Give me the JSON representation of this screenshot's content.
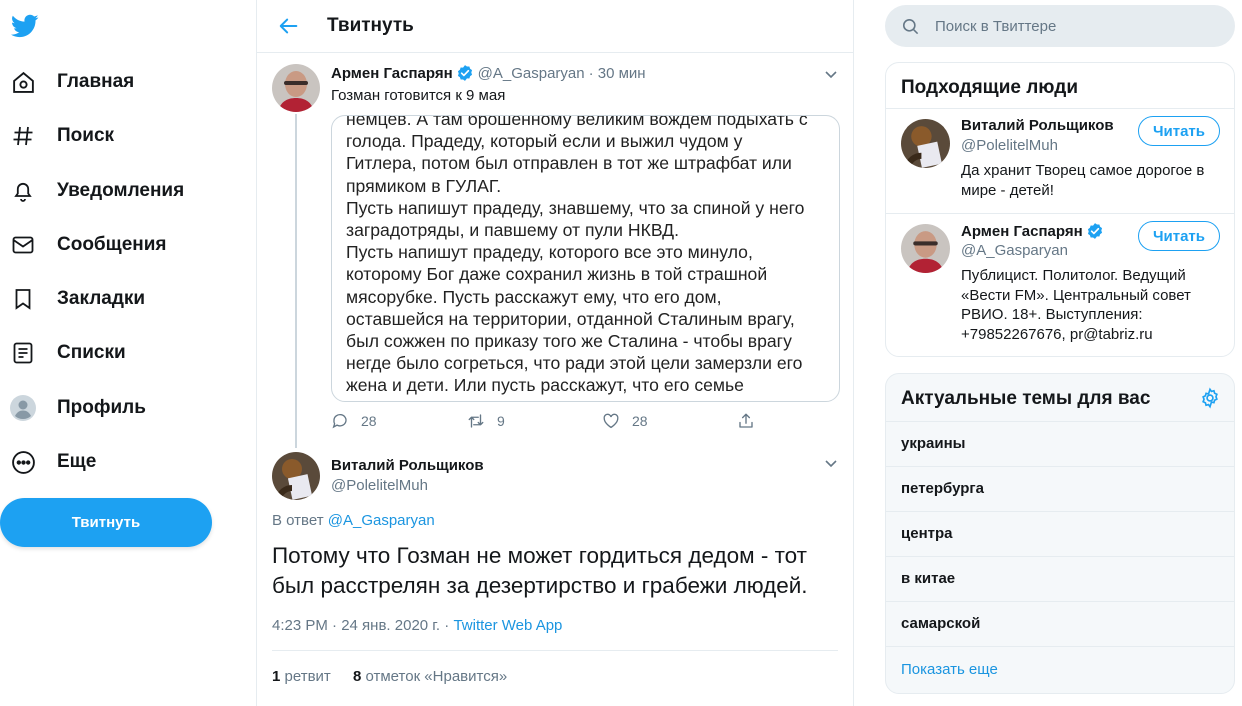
{
  "nav": {
    "items": [
      {
        "label": "Главная",
        "icon": "home-icon"
      },
      {
        "label": "Поиск",
        "icon": "hash-icon"
      },
      {
        "label": "Уведомления",
        "icon": "bell-icon"
      },
      {
        "label": "Сообщения",
        "icon": "envelope-icon"
      },
      {
        "label": "Закладки",
        "icon": "bookmark-icon"
      },
      {
        "label": "Списки",
        "icon": "list-icon"
      },
      {
        "label": "Профиль",
        "icon": "user-icon"
      },
      {
        "label": "Еще",
        "icon": "more-icon"
      }
    ],
    "tweet_button": "Твитнуть"
  },
  "header": {
    "title": "Твитнуть"
  },
  "parent_tweet": {
    "name": "Армен Гаспарян",
    "handle": "@A_Gasparyan",
    "time": "· 30 мин",
    "text": "Гозман готовится к 9 мая",
    "image_lines": [
      "немцев. А там брошенному великим вождем подыхать с",
      "голода. Прадеду, который если и выжил чудом у",
      "Гитлера, потом был отправлен в тот же штрафбат или",
      "прямиком в ГУЛАГ.",
      "Пусть напишут прадеду, знавшему, что за спиной у него",
      "заградотряды, и павшему от пули НКВД.",
      "Пусть напишут прадеду, которого все это минуло,",
      "которому Бог даже сохранил жизнь в той страшной",
      "мясорубке. Пусть расскажут ему, что его дом,",
      "оставшейся на территории, отданной Сталиным врагу,",
      "был сожжен по приказу того же Сталина - чтобы врагу",
      "негде было согреться, что ради этой цели замерзли его",
      "жена и дети. Или пусть расскажут, что его семье"
    ],
    "replies": "28",
    "retweets": "9",
    "likes": "28"
  },
  "main_tweet": {
    "name": "Виталий Рольщиков",
    "handle": "@PolelitelMuh",
    "reply_prefix": "В ответ",
    "reply_to": "@A_Gasparyan",
    "text": "Потому что Гозман не может гордиться дедом - тот был  расстрелян за дезертирство и грабежи людей.",
    "timestamp": "4:23 PM · 24 янв. 2020 г. · ",
    "source": "Twitter Web App",
    "retweet_count": "1",
    "retweet_label": "ретвит",
    "like_count": "8",
    "like_label": "отметок «Нравится»"
  },
  "search": {
    "placeholder": "Поиск в Твиттере"
  },
  "who_to_follow": {
    "title": "Подходящие люди",
    "follow_label": "Читать",
    "people": [
      {
        "name": "Виталий Рольщиков",
        "handle": "@PolelitelMuh",
        "bio": "Да хранит Творец самое дорогое в мире - детей!"
      },
      {
        "name": "Армен Гаспарян",
        "handle": "@A_Gasparyan",
        "bio": "Публицист. Политолог. Ведущий «Вести FM». Центральный совет РВИО. 18+. Выступления: +79852267676, pr@tabriz.ru"
      }
    ]
  },
  "trends": {
    "title": "Актуальные темы для вас",
    "items": [
      "украины",
      "петербурга",
      "центра",
      "в китае",
      "самарской"
    ],
    "show_more": "Показать еще"
  },
  "colors": {
    "accent": "#1da1f2",
    "link": "#1b95e0",
    "muted": "#657786",
    "border": "#e6ecf0"
  }
}
